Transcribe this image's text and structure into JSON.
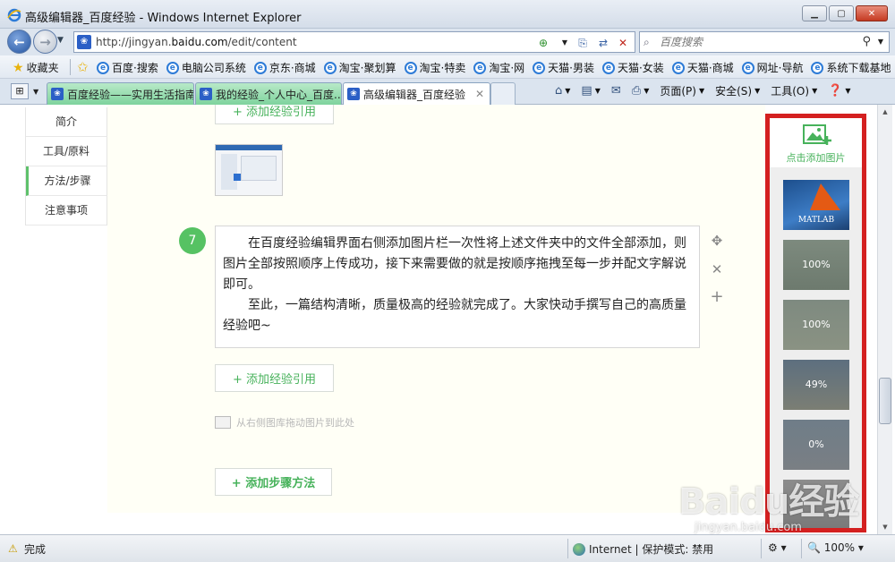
{
  "window": {
    "title": "高级编辑器_百度经验 - Windows Internet Explorer",
    "url_prefix": "http://jingyan.",
    "url_domain": "baidu.com",
    "url_path": "/edit/content",
    "search_placeholder": "百度搜索"
  },
  "favorites": {
    "button_label": "收藏夹",
    "links": [
      "百度·搜索",
      "电脑公司系统",
      "京东·商城",
      "淘宝·聚划算",
      "淘宝·特卖",
      "淘宝·网",
      "天猫·男装",
      "天猫·女装",
      "天猫·商城",
      "网址·导航",
      "系统下载基地"
    ]
  },
  "tabs": [
    {
      "label": "百度经验——实用生活指南"
    },
    {
      "label": "我的经验_个人中心_百度..."
    },
    {
      "label": "高级编辑器_百度经验"
    }
  ],
  "command_bar": {
    "page": "页面(P)",
    "safety": "安全(S)",
    "tools": "工具(O)"
  },
  "left_nav": {
    "items": [
      "简介",
      "工具/原料",
      "方法/步骤",
      "注意事项"
    ]
  },
  "editor": {
    "add_reference_top": "+ 添加经验引用",
    "step_number": "7",
    "step_paragraph_1": "在百度经验编辑界面右侧添加图片栏一次性将上述文件夹中的文件全部添加，则图片全部按照顺序上传成功，接下来需要做的就是按顺序拖拽至每一步并配文字解说即可。",
    "step_paragraph_2": "至此，一篇结构清晰，质量极高的经验就完成了。大家快动手撰写自己的高质量经验吧~",
    "add_reference": "+ 添加经验引用",
    "drag_hint": "从右侧图库拖动图片到此处",
    "add_step_method": "+ 添加步骤方法"
  },
  "image_panel": {
    "add_label": "点击添加图片",
    "thumbnails": [
      {
        "kind": "matlab",
        "text": "MATLAB"
      },
      {
        "kind": "upload",
        "text": "100%"
      },
      {
        "kind": "upload",
        "text": "100%"
      },
      {
        "kind": "upload",
        "text": "49%"
      },
      {
        "kind": "upload",
        "text": "0%"
      }
    ]
  },
  "watermark": {
    "brand": "Baidu经验",
    "sub": "jingyan.baidu.com"
  },
  "statusbar": {
    "status": "完成",
    "zone": "Internet | 保护模式: 禁用",
    "zoom": "100%"
  },
  "colors": {
    "accent_green": "#47b25b",
    "highlight_red": "#d42020",
    "ie_blue": "#2d7bd7"
  }
}
